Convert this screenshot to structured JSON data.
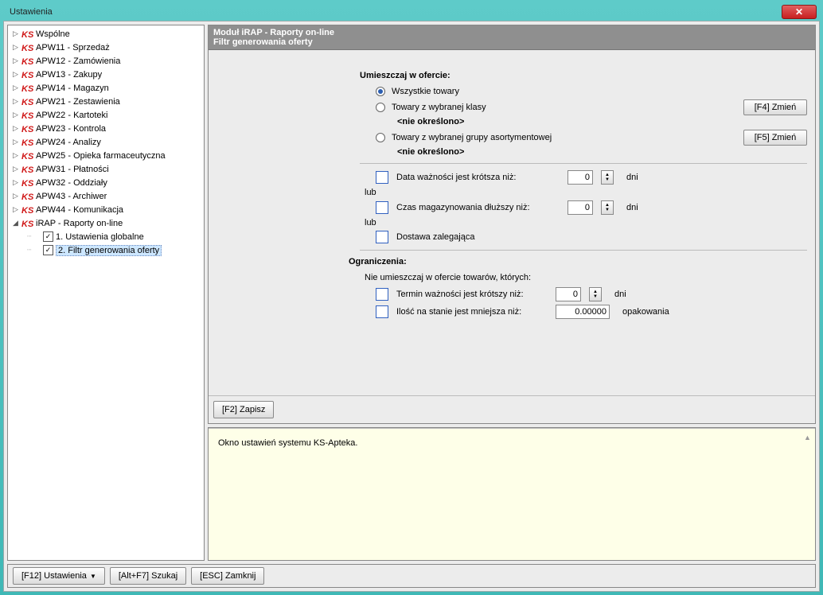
{
  "window": {
    "title": "Ustawienia"
  },
  "tree": {
    "items": [
      "Wspólne",
      "APW11 - Sprzedaż",
      "APW12 - Zamówienia",
      "APW13 - Zakupy",
      "APW14 - Magazyn",
      "APW21 - Zestawienia",
      "APW22 - Kartoteki",
      "APW23 - Kontrola",
      "APW24 - Analizy",
      "APW25 - Opieka farmaceutyczna",
      "APW31 - Płatności",
      "APW32 - Oddziały",
      "APW43 - Archiwer",
      "APW44 - Komunikacja"
    ],
    "expanded_item": "iRAP - Raporty on-line",
    "children": [
      "1. Ustawienia globalne",
      "2. Filtr generowania oferty"
    ]
  },
  "pane_header": {
    "line1": "Moduł iRAP - Raporty on-line",
    "line2": "Filtr generowania oferty"
  },
  "form": {
    "section1": "Umieszczaj w ofercie:",
    "radio1": "Wszystkie towary",
    "radio2": "Towary z wybranej klasy",
    "radio2_note": "<nie określono>",
    "radio3": "Towary z wybranej grupy asortymentowej",
    "radio3_note": "<nie określono>",
    "change1": "[F4] Zmień",
    "change2": "[F5] Zmień",
    "chk1": "Data ważności jest krótsza niż:",
    "chk1_val": "0",
    "chk1_unit": "dni",
    "or": "lub",
    "chk2": "Czas magazynowania dłuższy niż:",
    "chk2_val": "0",
    "chk2_unit": "dni",
    "chk3": "Dostawa zalegająca",
    "section2": "Ograniczenia:",
    "limit_text": "Nie umieszczaj w ofercie towarów, których:",
    "chk4": "Termin ważności jest krótszy niż:",
    "chk4_val": "0",
    "chk4_unit": "dni",
    "chk5": "Ilość na stanie jest mniejsza niż:",
    "chk5_val": "0.00000",
    "chk5_unit": "opakowania",
    "save_btn": "[F2] Zapisz"
  },
  "info": {
    "text": "Okno ustawień systemu KS-Apteka."
  },
  "bottom": {
    "b1": "[F12] Ustawienia",
    "b2": "[Alt+F7] Szukaj",
    "b3": "[ESC] Zamknij"
  }
}
